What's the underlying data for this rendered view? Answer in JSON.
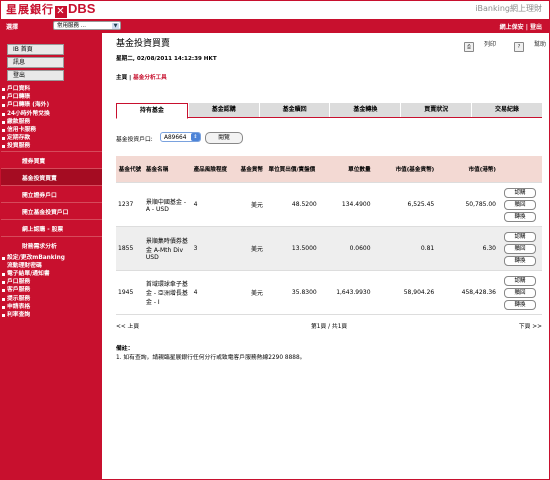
{
  "header": {
    "logo_cn": "星展銀行",
    "logo_x": "✕",
    "logo_en": "DBS",
    "product": "iBanking網上理財",
    "select_label": "選擇",
    "quick_select": "常用服務 ...",
    "links": "網上保安 | 登出"
  },
  "sidebar": {
    "buttons": [
      "IB 首頁",
      "訊息",
      "登出"
    ],
    "menu_top": [
      "戶口資料",
      "戶口轉賬",
      "戶口轉賬 (海外)",
      "24小時外幣兌換",
      "繳款服務",
      "信用卡服務",
      "定期存款",
      "投資服務"
    ],
    "sub": [
      "證券買賣",
      "基金投資買賣",
      "開立證券戶口",
      "開立基金投資戶口",
      "網上認購 - 股票",
      "財務需求分析"
    ],
    "sub_active": 1,
    "menu_bottom": [
      "設定/更改mBanking",
      "流動理財密碼",
      "電子結單/通知書",
      "戶口服務",
      "客戶服務",
      "提示服務",
      "申請表格",
      "利率查詢"
    ]
  },
  "main": {
    "title": "基金投資買賣",
    "print": "列印",
    "help": "幫助",
    "datetime": "星期二, 02/08/2011 14:12:39 HKT",
    "breadcrumb_home": "主頁",
    "breadcrumb_sep": " | ",
    "breadcrumb_link": "基金分析工具",
    "tabs": [
      "持有基金",
      "基金認購",
      "基金贖回",
      "基金轉換",
      "買賣狀況",
      "交易紀錄"
    ],
    "account_label": "基金投資戶口:",
    "account_value": "A89664",
    "view_button": "閱覽",
    "columns": [
      "基金代號",
      "基金名稱",
      "產品風險程度",
      "基金貨幣",
      "單位買出價/賣盤價",
      "單位數量",
      "市值(基金貨幣)",
      "市值(港幣)",
      ""
    ],
    "rows": [
      {
        "code": "1237",
        "name": "景順中國基金 - A - USD",
        "risk": "4",
        "ccy": "美元",
        "price": "48.5200",
        "units": "134.4900",
        "mv_ccy": "6,525.45",
        "mv_hkd": "50,785.00"
      },
      {
        "code": "1855",
        "name": "景順集時債券基金 A-Mth Div USD",
        "risk": "3",
        "ccy": "美元",
        "price": "13.5000",
        "units": "0.0600",
        "mv_ccy": "0.81",
        "mv_hkd": "6.30"
      },
      {
        "code": "1945",
        "name": "首域環球傘子基金 - 亞洲增長基金 - I",
        "risk": "4",
        "ccy": "美元",
        "price": "35.8300",
        "units": "1,643.9930",
        "mv_ccy": "58,904.26",
        "mv_hkd": "458,428.36"
      }
    ],
    "actions": [
      "認購",
      "贖回",
      "轉換"
    ],
    "prev": "<< 上頁",
    "page": "第1頁 / 共1頁",
    "next": "下頁 >>",
    "notes_title": "備註：",
    "note1": "1. 如有查詢，請親臨星展銀行任何分行或致電客戶服務熱線2290 8888。"
  }
}
